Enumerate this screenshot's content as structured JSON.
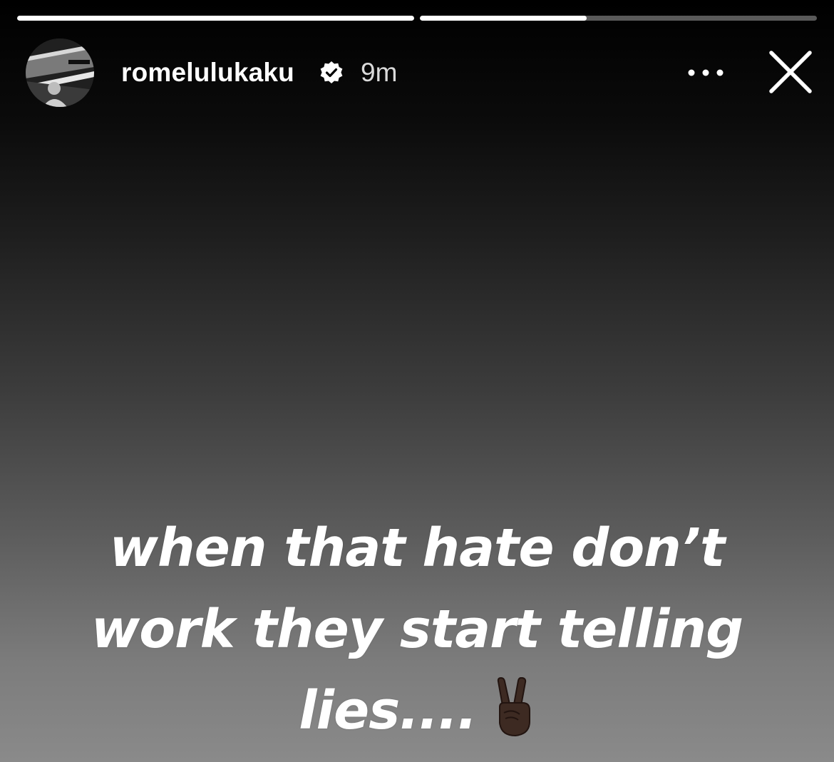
{
  "story": {
    "progress": [
      1.0,
      0.42
    ],
    "account": {
      "username": "romelulukaku",
      "verified": true,
      "time_ago": "9m",
      "avatar_icon": "profile-photo"
    },
    "actions": {
      "more_icon": "more-horizontal-icon",
      "close_icon": "close-icon"
    },
    "caption": {
      "lines": [
        "when that hate don’t",
        "work they start telling",
        "lies...."
      ],
      "emoji": "victory-hand-dark-skin-tone-icon"
    },
    "colors": {
      "text": "#ffffff",
      "background_top": "#000000",
      "background_bottom": "#8a8a8a",
      "verified_badge": "#ffffff"
    }
  }
}
